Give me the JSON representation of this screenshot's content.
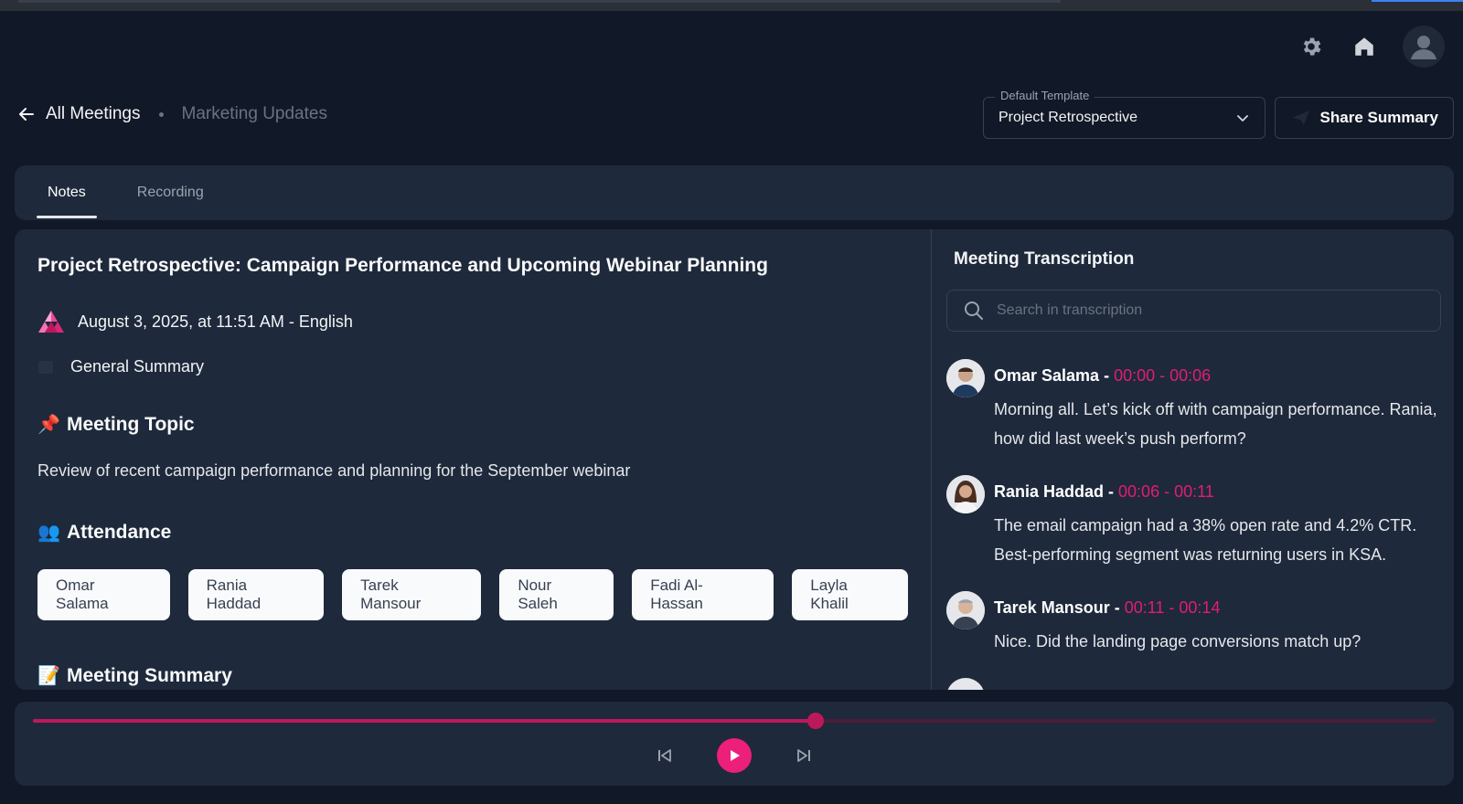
{
  "header": {
    "icons": [
      "gear-icon",
      "home-icon",
      "user-avatar-icon"
    ]
  },
  "breadcrumb": {
    "back_label": "All Meetings",
    "current": "Marketing Updates"
  },
  "template": {
    "label": "Default Template",
    "value": "Project Retrospective"
  },
  "share": {
    "label": "Share Summary"
  },
  "tabs": [
    {
      "label": "Notes",
      "active": true
    },
    {
      "label": "Recording",
      "active": false
    }
  ],
  "notes": {
    "title": "Project Retrospective: Campaign Performance and Upcoming Webinar Planning",
    "date_line": "August 3, 2025, at 11:51 AM - English",
    "summary_type": "General Summary",
    "topic_heading": "Meeting Topic",
    "topic_text": "Review of recent campaign performance and planning for the September webinar",
    "attendance_heading": "Attendance",
    "attendees": [
      "Omar Salama",
      "Rania Haddad",
      "Tarek Mansour",
      "Nour Saleh",
      "Fadi Al-Hassan",
      "Layla Khalil"
    ],
    "summary_heading": "Meeting Summary"
  },
  "transcript": {
    "title": "Meeting Transcription",
    "search_placeholder": "Search in transcription",
    "entries": [
      {
        "speaker": "Omar Salama",
        "sep": " - ",
        "time": "00:00 - 00:06",
        "text": "Morning all. Let’s kick off with campaign performance. Rania, how did last week’s push perform?"
      },
      {
        "speaker": "Rania Haddad",
        "sep": " - ",
        "time": "00:06 - 00:11",
        "text": "The email campaign had a 38% open rate and 4.2% CTR. Best-performing segment was returning users in KSA."
      },
      {
        "speaker": "Tarek Mansour",
        "sep": " - ",
        "time": "00:11 - 00:14",
        "text": "Nice. Did the landing page conversions match up?"
      }
    ]
  },
  "player": {
    "progress": 0.558
  },
  "colors": {
    "accent": "#ec1f7a",
    "timestamp": "#e11d74",
    "background": "#111827",
    "panel": "#1e293b"
  }
}
